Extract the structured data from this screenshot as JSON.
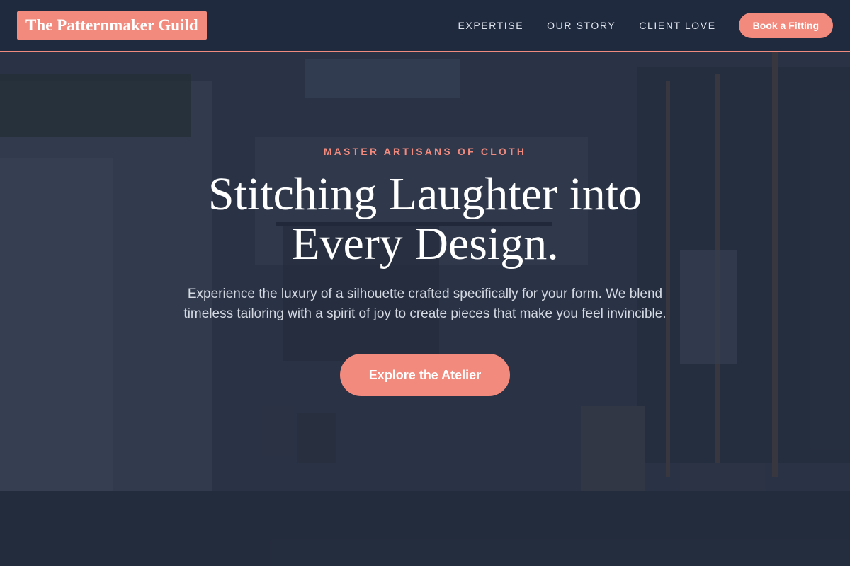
{
  "header": {
    "logo": "The Patternmaker Guild",
    "nav": [
      {
        "label": "EXPERTISE"
      },
      {
        "label": "OUR STORY"
      },
      {
        "label": "CLIENT LOVE"
      }
    ],
    "cta_label": "Book a Fitting"
  },
  "hero": {
    "eyebrow": "MASTER ARTISANS OF CLOTH",
    "headline": "Stitching Laughter into Every Design.",
    "lede": "Experience the luxury of a silhouette crafted specifically for your form. We blend timeless tailoring with a spirit of joy to create pieces that make you feel invincible.",
    "cta_label": "Explore the Atelier"
  },
  "colors": {
    "accent": "#f28a7e",
    "header_bg": "#1f2a3f",
    "hero_overlay": "#1e2738"
  }
}
